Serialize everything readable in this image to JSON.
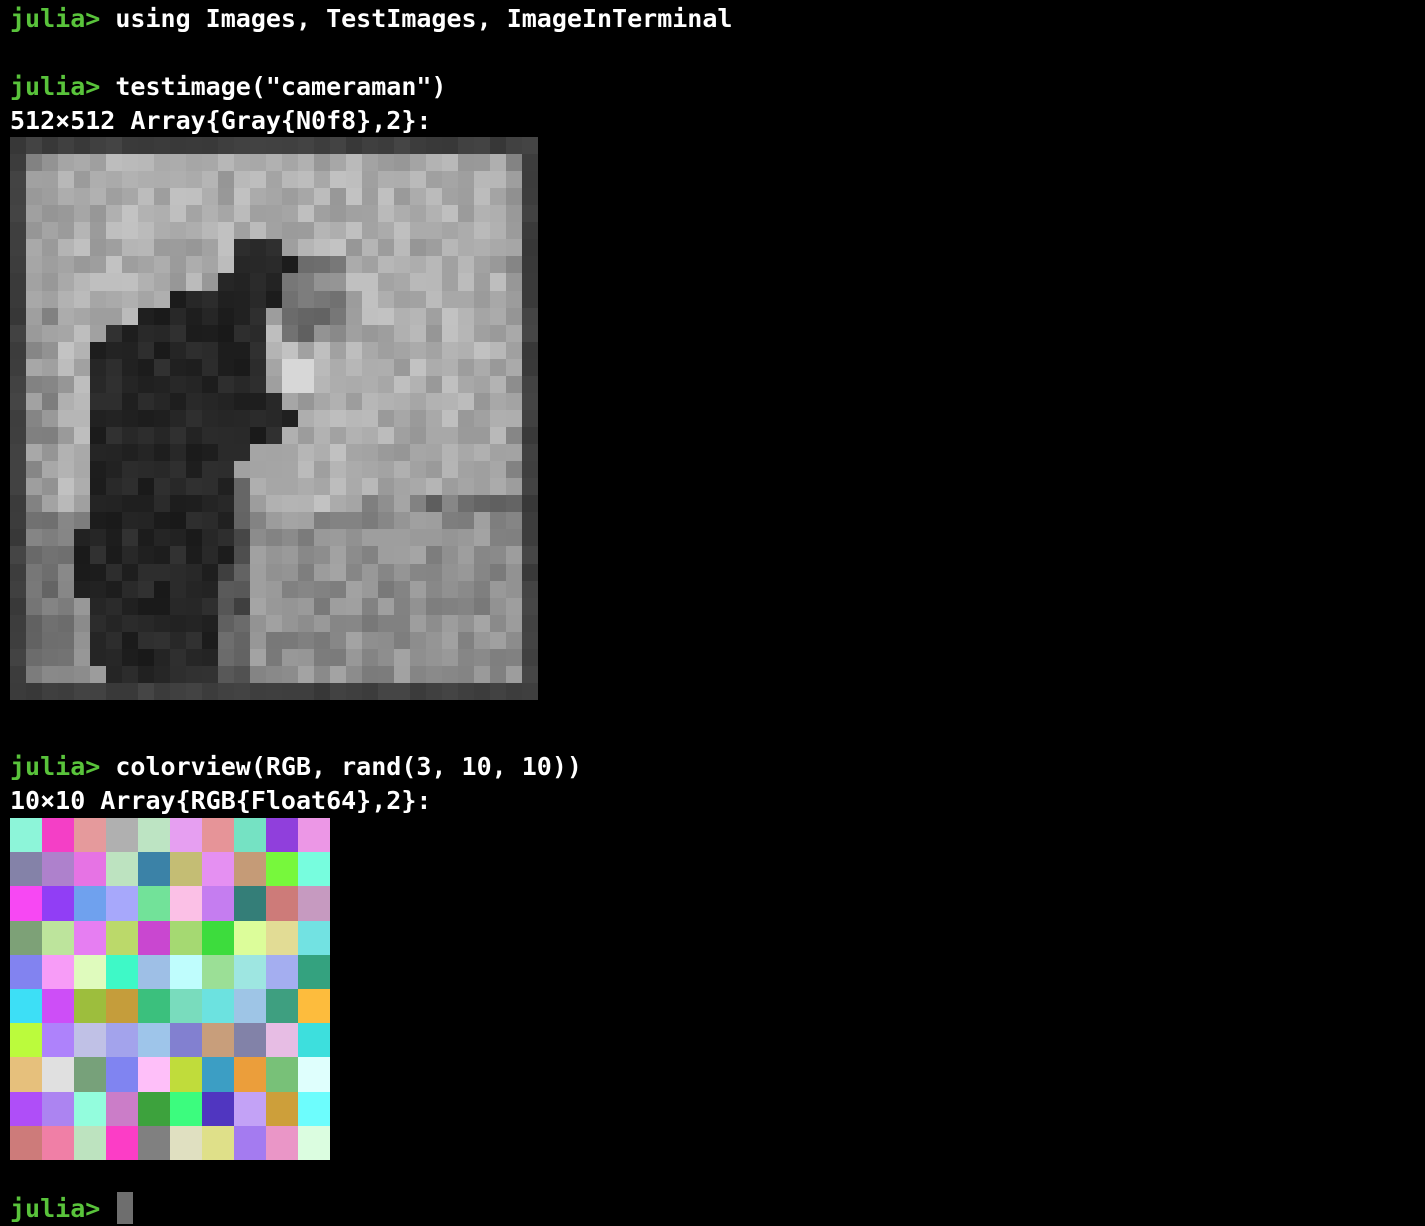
{
  "terminal": {
    "prompt": "julia> ",
    "commands": [
      {
        "input": "using Images, TestImages, ImageInTerminal",
        "output": ""
      },
      {
        "input": "testimage(\"cameraman\")",
        "output": "512×512 Array{Gray{N0f8},2}:"
      },
      {
        "input": "colorview(RGB, rand(3, 10, 10))",
        "output": "10×10 Array{RGB{Float64},2}:"
      }
    ],
    "current_input": ""
  },
  "colors": {
    "prompt": "#59c33b",
    "text": "#ffffff",
    "background": "#000000",
    "cursor": "#6e6e6e"
  },
  "images": {
    "cameraman": {
      "type": "grayscale",
      "rows": 33,
      "cols": 33
    },
    "color_grid": {
      "type": "rgb",
      "rows": 10,
      "cols": 10,
      "palette": [
        [
          "#8df5d9",
          "#f43fc6",
          "#e59a9c",
          "#b0b0b0",
          "#bde4c3",
          "#e69ff1",
          "#e69498",
          "#75e2c3",
          "#903fdc",
          "#ec97e6"
        ],
        [
          "#8482a8",
          "#ae81cc",
          "#e673e4",
          "#bde3c0",
          "#3b82a7",
          "#c4bd74",
          "#e590f2",
          "#c59b77",
          "#77f83c",
          "#77fdde"
        ],
        [
          "#f748f3",
          "#913ef5",
          "#6fa1ee",
          "#a7a8fb",
          "#72e299",
          "#fbc0e6",
          "#c57df0",
          "#347e78",
          "#cd7b79",
          "#c69ac0"
        ],
        [
          "#7da177",
          "#bde49c",
          "#e67ef2",
          "#bbd96a",
          "#c947d0",
          "#a5d972",
          "#3ddc3d",
          "#dcfd9a",
          "#e2dc95",
          "#72e2e2"
        ],
        [
          "#8283f0",
          "#f79cf7",
          "#dffbbd",
          "#3ef9c7",
          "#9ebfe6",
          "#bffdfd",
          "#9bdf96",
          "#9ee6e1",
          "#a4aef0",
          "#34a27f"
        ],
        [
          "#3ddff6",
          "#cd4ef7",
          "#9dbe3d",
          "#c59d3b",
          "#3bc07d",
          "#79dcbd",
          "#6ce2e0",
          "#9ec5e6",
          "#3e9f80",
          "#fdbc3d"
        ],
        [
          "#bbfb3c",
          "#ae82fb",
          "#c0c1e6",
          "#a3a3ec",
          "#9ec5ea",
          "#8280d0",
          "#c89e7b",
          "#8282a8",
          "#e7bde4",
          "#3ddfdd"
        ],
        [
          "#e6c07c",
          "#e0e0e0",
          "#77a17a",
          "#8084f1",
          "#febff9",
          "#c0dc3b",
          "#3c9ec4",
          "#eb9e3b",
          "#78c178",
          "#dffffd"
        ],
        [
          "#af4ef8",
          "#ac84f1",
          "#93fddd",
          "#cb7dc8",
          "#3da23d",
          "#3cfc7e",
          "#5036c0",
          "#c3a2f6",
          "#cd9f3a",
          "#6dfdfd"
        ],
        [
          "#cd7b7a",
          "#f07fa6",
          "#bde3bf",
          "#fc3dc6",
          "#808080",
          "#e0e0c1",
          "#dfe089",
          "#a47bf0",
          "#ea96c7",
          "#dbfde0"
        ]
      ]
    }
  }
}
